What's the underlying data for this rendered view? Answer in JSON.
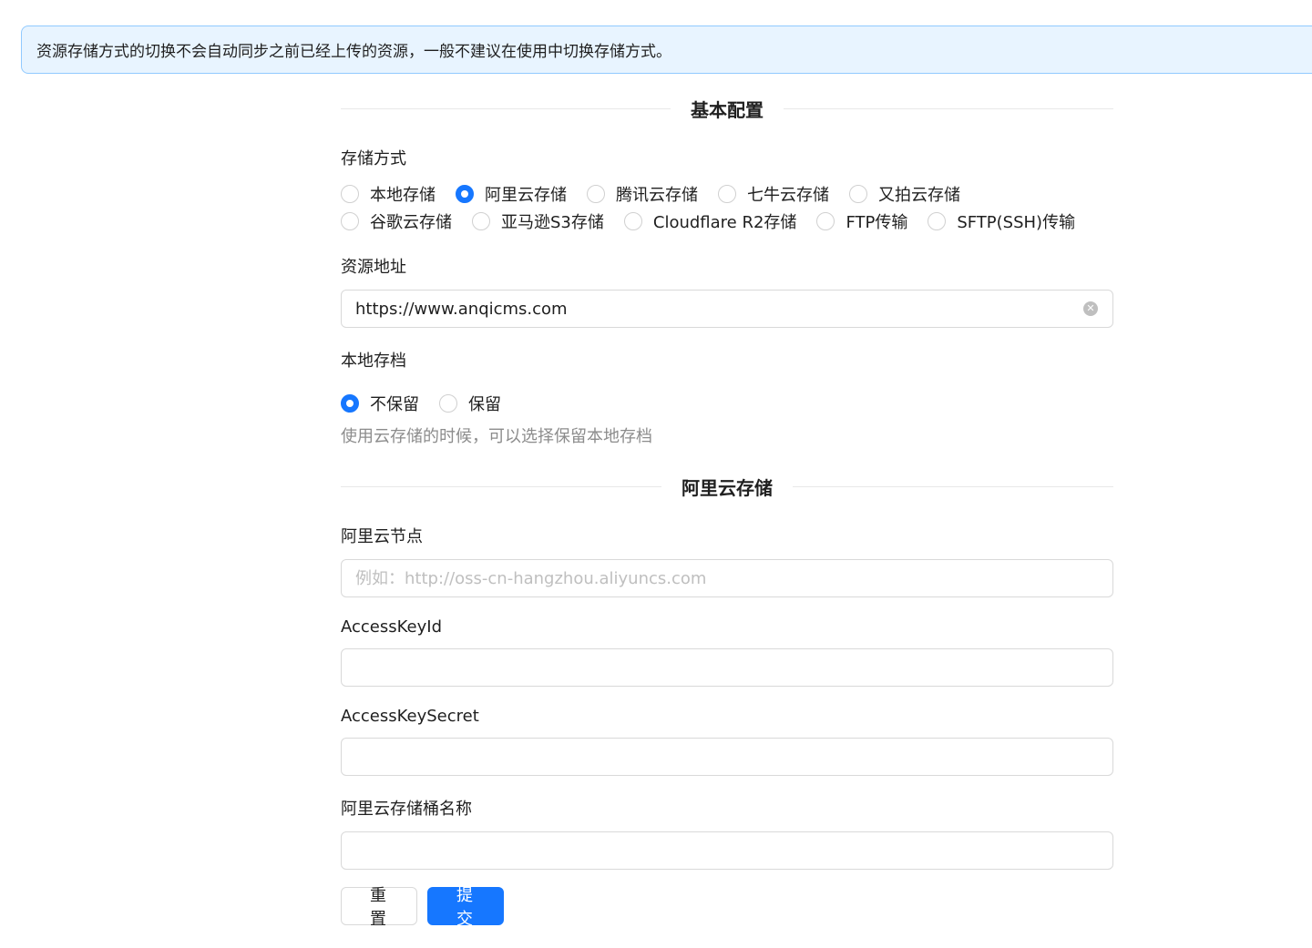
{
  "alert": {
    "text": "资源存储方式的切换不会自动同步之前已经上传的资源，一般不建议在使用中切换存储方式。"
  },
  "section_basic": {
    "title": "基本配置"
  },
  "storage_type": {
    "label": "存储方式",
    "row1": [
      "本地存储",
      "阿里云存储",
      "腾讯云存储",
      "七牛云存储",
      "又拍云存储"
    ],
    "row2": [
      "谷歌云存储",
      "亚马逊S3存储",
      "Cloudflare R2存储",
      "FTP传输",
      "SFTP(SSH)传输"
    ],
    "selected": "阿里云存储"
  },
  "resource_url": {
    "label": "资源地址",
    "value": "https://www.anqicms.com"
  },
  "local_archive": {
    "label": "本地存档",
    "options": [
      "不保留",
      "保留"
    ],
    "selected": "不保留",
    "hint": "使用云存储的时候，可以选择保留本地存档"
  },
  "section_aliyun": {
    "title": "阿里云存储"
  },
  "aliyun_endpoint": {
    "label": "阿里云节点",
    "placeholder": "例如：http://oss-cn-hangzhou.aliyuncs.com",
    "value": ""
  },
  "access_key_id": {
    "label": "AccessKeyId",
    "value": ""
  },
  "access_key_secret": {
    "label": "AccessKeySecret",
    "value": ""
  },
  "bucket_name": {
    "label": "阿里云存储桶名称",
    "value": ""
  },
  "buttons": {
    "reset": "重 置",
    "submit": "提 交"
  },
  "colors": {
    "primary": "#1677ff",
    "alert_bg": "#e8f4ff",
    "alert_border": "#91caff"
  }
}
